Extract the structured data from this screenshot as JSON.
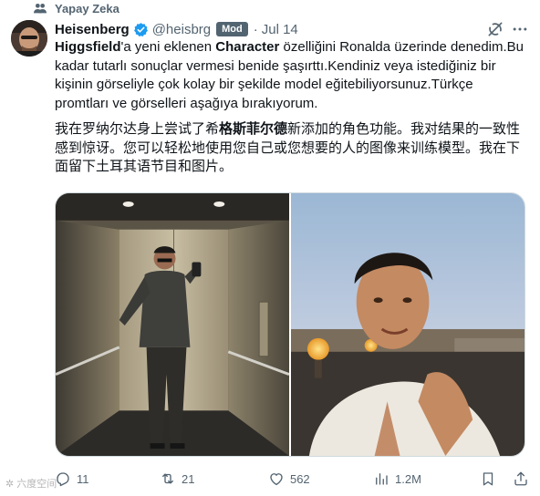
{
  "social_context": {
    "text": "Yapay Zeka"
  },
  "author": {
    "display_name": "Heisenberg",
    "handle": "@heisbrg",
    "badge": "Mod",
    "separator": "·",
    "date": "Jul 14"
  },
  "tweet": {
    "tr": {
      "seg1": "Higgsfield",
      "seg2": "'a yeni eklenen ",
      "seg3": "Character",
      "seg4": " özelliğini Ronalda üzerinde denedim.Bu kadar tutarlı sonuçlar vermesi benide şaşırttı.Kendiniz veya istediğiniz bir kişinin görseliyle çok kolay bir şekilde model eğitebiliyorsunuz.Türkçe promtları ve görselleri aşağıya bırakıyorum."
    },
    "zh": {
      "seg1": "我在罗纳尔达身上尝试了希",
      "seg2": "格斯菲尔德",
      "seg3": "新添加的角色功能。我对结果的一致性感到惊讶。您可以轻松地使用您自己或您想要的人的图像来训练模型。我在下面留下土耳其语节目和图片。"
    }
  },
  "actions": {
    "replies": "11",
    "reposts": "21",
    "likes": "562",
    "views": "1.2M"
  },
  "watermark": {
    "text": "六度空间"
  },
  "colors": {
    "secondary": "#536471",
    "verified": "#1d9bf0",
    "border": "#cfd9de"
  },
  "icons": [
    "people-icon",
    "verified-icon",
    "grok-icon",
    "more-icon",
    "reply-icon",
    "repost-icon",
    "like-icon",
    "views-icon",
    "bookmark-icon",
    "share-icon"
  ]
}
